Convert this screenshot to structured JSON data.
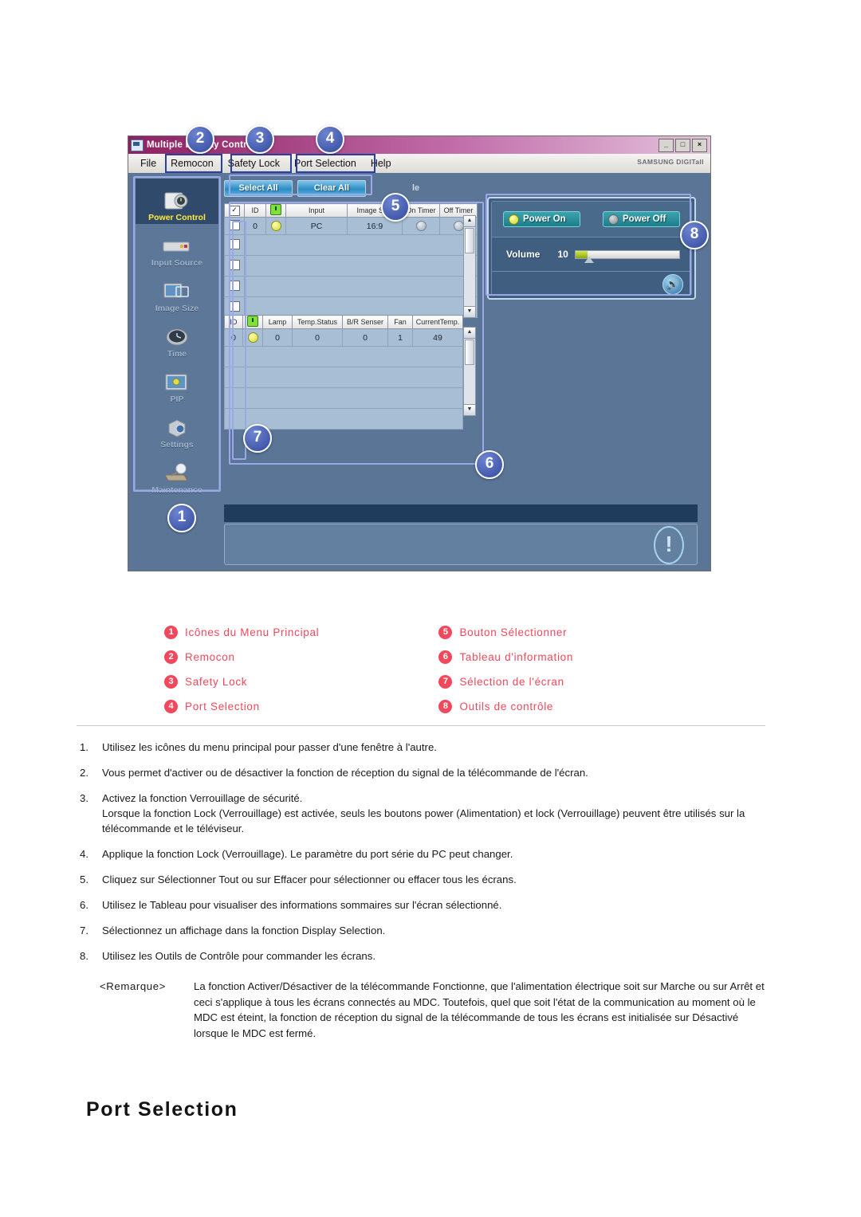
{
  "app": {
    "window_title": "Multiple Display Control",
    "window_buttons": [
      "_",
      "□",
      "×"
    ],
    "brand": "SAMSUNG DIGITall",
    "menu": [
      "File",
      "Remocon",
      "Safety Lock",
      "Port Selection",
      "Help"
    ],
    "sidebar": [
      {
        "label": "Power Control",
        "icon": "power-control-icon",
        "active": true
      },
      {
        "label": "Input Source",
        "icon": "input-source-icon",
        "active": false
      },
      {
        "label": "Image Size",
        "icon": "image-size-icon",
        "active": false
      },
      {
        "label": "Time",
        "icon": "clock-icon",
        "active": false
      },
      {
        "label": "PIP",
        "icon": "pip-icon",
        "active": false
      },
      {
        "label": "Settings",
        "icon": "settings-cube-icon",
        "active": false
      },
      {
        "label": "Maintenance",
        "icon": "maintenance-icon",
        "active": false
      }
    ],
    "buttons": {
      "select_all": "Select All",
      "clear_all": "Clear All",
      "partial_text": "le"
    },
    "display_table": {
      "headers": [
        "",
        "ID",
        "",
        "Input",
        "Image Size",
        "On Timer",
        "Off Timer"
      ],
      "rows": [
        {
          "checked": false,
          "id": "0",
          "power": "on",
          "input": "PC",
          "image_size": "16:9",
          "on_timer": "circle",
          "off_timer": "circle"
        }
      ],
      "empty_rows": 5
    },
    "status_table": {
      "headers": [
        "ID",
        "",
        "Lamp",
        "Temp.Status",
        "B/R Senser",
        "Fan",
        "CurrentTemp."
      ],
      "rows": [
        {
          "id": "0",
          "power": "on",
          "lamp": "0",
          "temp_status": "0",
          "br_senser": "0",
          "fan": "1",
          "current_temp": "49"
        }
      ],
      "empty_rows": 4
    },
    "tools": {
      "power_on": "Power On",
      "power_off": "Power Off",
      "volume_label": "Volume",
      "volume_value": "10",
      "mute_icon": "speaker-icon"
    },
    "badges": [
      "1",
      "2",
      "3",
      "4",
      "5",
      "6",
      "7",
      "8"
    ]
  },
  "legend": {
    "left": [
      {
        "num": "1",
        "text": "Icônes du Menu Principal"
      },
      {
        "num": "2",
        "text": "Remocon"
      },
      {
        "num": "3",
        "text": "Safety Lock"
      },
      {
        "num": "4",
        "text": "Port Selection"
      }
    ],
    "right": [
      {
        "num": "5",
        "text": "Bouton Sélectionner"
      },
      {
        "num": "6",
        "text": "Tableau d'information"
      },
      {
        "num": "7",
        "text": "Sélection de l'écran"
      },
      {
        "num": "8",
        "text": "Outils de contrôle"
      }
    ]
  },
  "steps": [
    {
      "num": "1.",
      "text": "Utilisez les icônes du menu principal pour passer d'une fenêtre à l'autre."
    },
    {
      "num": "2.",
      "text": "Vous permet d'activer ou de désactiver la fonction de réception du signal de la télécommande de l'écran."
    },
    {
      "num": "3.",
      "text": "Activez la fonction Verrouillage de sécurité.\nLorsque la fonction Lock (Verrouillage) est activée, seuls les boutons power (Alimentation) et lock (Verrouillage) peuvent être utilisés sur la télécommande et le téléviseur."
    },
    {
      "num": "4.",
      "text": "Applique la fonction Lock (Verrouillage). Le paramètre du port série du PC peut changer."
    },
    {
      "num": "5.",
      "text": "Cliquez sur Sélectionner Tout ou sur Effacer pour sélectionner ou effacer tous les écrans."
    },
    {
      "num": "6.",
      "text": "Utilisez le Tableau pour visualiser des informations sommaires sur l'écran sélectionné."
    },
    {
      "num": "7.",
      "text": "Sélectionnez un affichage dans la fonction Display Selection."
    },
    {
      "num": "8.",
      "text": "Utilisez les Outils de Contrôle pour commander les écrans."
    }
  ],
  "note": {
    "label": "<Remarque>",
    "text": "La fonction Activer/Désactiver de la télécommande Fonctionne, que l'alimentation électrique soit sur Marche ou sur Arrêt et ceci s'applique à tous les écrans connectés au MDC. Toutefois, quel que soit l'état de la communication au moment où le MDC est éteint, la fonction de réception du signal de la télécommande de tous les écrans est initialisée sur Désactivé lorsque le MDC est fermé."
  },
  "section_title": "Port Selection",
  "colors": {
    "legend_red": "#f2485b",
    "badge_blue": "#33499e",
    "highlight_blue": "#2b3fa0",
    "titlebar_magenta": "#8e2060",
    "active_label_yellow": "#ffe93a",
    "teal_button": "#1d7e8c"
  }
}
